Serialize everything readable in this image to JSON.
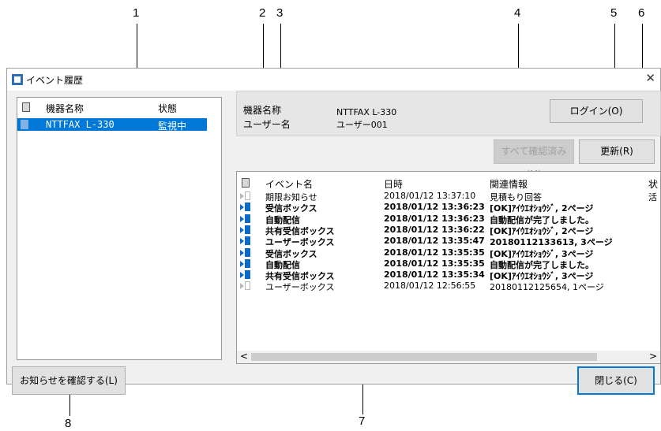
{
  "callouts": [
    "1",
    "2",
    "3",
    "4",
    "5",
    "6",
    "7",
    "8"
  ],
  "window": {
    "title": "イベント履歴",
    "close_icon": "close-icon",
    "app_icon": "app-icon"
  },
  "device_list": {
    "col_name": "機器名称",
    "col_status": "状態",
    "rows": [
      {
        "name": "NTTFAX L-330",
        "status": "監視中",
        "selected": true
      }
    ]
  },
  "info": {
    "device_label": "機器名称",
    "device_value": "NTTFAX L-330",
    "user_label": "ユーザー名",
    "user_value": "ユーザー001"
  },
  "buttons": {
    "login": "ログイン(O)",
    "confirm_all": "すべて確認済み(M)",
    "refresh": "更新(R)",
    "confirm_notice": "お知らせを確認する(L)",
    "close": "閉じる(C)"
  },
  "events": {
    "headers": [
      "イベント名",
      "日時",
      "関連情報",
      "状"
    ],
    "rows": [
      {
        "name": "期限お知らせ",
        "datetime": "2018/01/12 13:37:10",
        "info": "見積もり回答",
        "status": "活",
        "unread": false
      },
      {
        "name": "受信ボックス",
        "datetime": "2018/01/12 13:36:23",
        "info": "[OK]ｱｲｳｴｵｼｮｳｼﾞ, 2ページ",
        "status": "",
        "unread": true
      },
      {
        "name": "自動配信",
        "datetime": "2018/01/12 13:36:23",
        "info": "自動配信が完了しました。",
        "status": "",
        "unread": true
      },
      {
        "name": "共有受信ボックス",
        "datetime": "2018/01/12 13:36:22",
        "info": "[OK]ｱｲｳｴｵｼｮｳｼﾞ, 2ページ",
        "status": "",
        "unread": true
      },
      {
        "name": "ユーザーボックス",
        "datetime": "2018/01/12 13:35:47",
        "info": "20180112133613, 3ページ",
        "status": "",
        "unread": true
      },
      {
        "name": "受信ボックス",
        "datetime": "2018/01/12 13:35:35",
        "info": "[OK]ｱｲｳｴｵｼｮｳｼﾞ, 3ページ",
        "status": "",
        "unread": true
      },
      {
        "name": "自動配信",
        "datetime": "2018/01/12 13:35:35",
        "info": "自動配信が完了しました。",
        "status": "",
        "unread": true
      },
      {
        "name": "共有受信ボックス",
        "datetime": "2018/01/12 13:35:34",
        "info": "[OK]ｱｲｳｴｵｼｮｳｼﾞ, 3ページ",
        "status": "",
        "unread": true
      },
      {
        "name": "ユーザーボックス",
        "datetime": "2018/01/12 12:56:55",
        "info": "20180112125654, 1ページ",
        "status": "",
        "unread": false
      }
    ]
  },
  "scroll": {
    "left_arrow": "<",
    "right_arrow": ">"
  }
}
